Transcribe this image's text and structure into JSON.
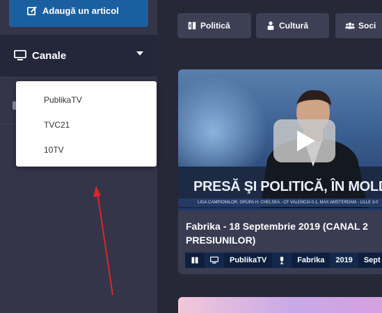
{
  "sidebar": {
    "add_article_label": "Adaugă un articol",
    "channels_label": "Canale",
    "channels_options": [
      "PublikaTV",
      "TVC21",
      "10TV"
    ]
  },
  "categories": [
    {
      "label": "Politică",
      "icon": "book-icon"
    },
    {
      "label": "Cultură",
      "icon": "person-icon"
    },
    {
      "label": "Soci",
      "icon": "users-icon"
    }
  ],
  "card": {
    "banner_text": "PRESĂ ŞI POLITICĂ, ÎN MOLDOVA",
    "ticker_text": "LIGA CAMPIONILOR, GRUPA H: CHELSEA - CF VALENCIA 0-1, MAX AMSTERDAM - LILLE 3-0",
    "title_line1": "Fabrika - 18 Septembrie 2019 (CANAL 2",
    "title_line2": "PRESIUNILOR)",
    "meta": {
      "channel": "PublikaTV",
      "show": "Fabrika",
      "year": "2019",
      "month": "Sept"
    }
  },
  "colors": {
    "accent": "#1a5fa0",
    "sidebar": "#343548",
    "background": "#262837",
    "annotation_arrow": "#e0242b"
  }
}
